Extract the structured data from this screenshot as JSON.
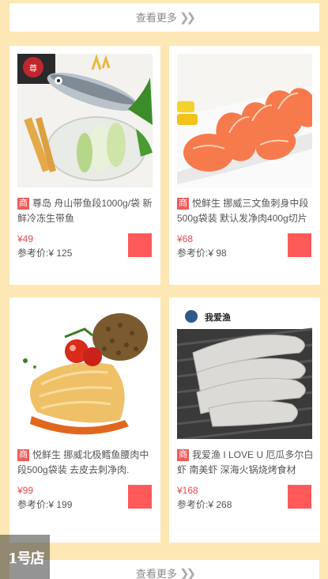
{
  "more_label": "查看更多",
  "more_icon": "double-chevron-right-icon",
  "badge": "商",
  "products": [
    {
      "title": "尊岛 舟山带鱼段1000g/袋 新鲜冷冻生带鱼",
      "price": "¥49",
      "ref": "参考价:¥ 125"
    },
    {
      "title": "悦鲜生 挪威三文鱼刺身中段500g袋装 默认发净肉400g切片",
      "price": "¥68",
      "ref": "参考价:¥ 98"
    },
    {
      "title": "悦鲜生 挪威北极鳕鱼腰肉中段500g袋装 去皮去刺净肉.",
      "price": "¥99",
      "ref": "参考价:¥ 199"
    },
    {
      "title": "我爱渔 I LOVE U 厄瓜多尔白虾 南美虾 深海火锅烧烤食材",
      "price": "¥168",
      "ref": "参考价:¥ 268"
    }
  ],
  "float_logo": {
    "label": "1号店",
    "icon": "chevron-right-icon"
  },
  "colors": {
    "background": "#fde7b4",
    "badge": "#ef5b5b",
    "price": "#e8494e",
    "cart": "#fe5a59"
  }
}
